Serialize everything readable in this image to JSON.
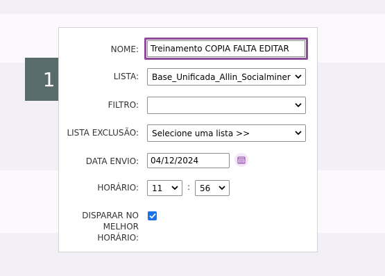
{
  "step": {
    "number": "1"
  },
  "form": {
    "nome": {
      "label": "NOME:",
      "value": "Treinamento COPIA FALTA EDITAR"
    },
    "lista": {
      "label": "LISTA:",
      "value": "Base_Unificada_Allin_Socialminer"
    },
    "filtro": {
      "label": "FILTRO:",
      "value": ""
    },
    "lista_exclusao": {
      "label": "LISTA EXCLUSÃO:",
      "value": "Selecione uma lista >>"
    },
    "data_envio": {
      "label": "DATA ENVIO:",
      "value": "04/12/2024"
    },
    "horario": {
      "label": "HORÁRIO:",
      "hour": "11",
      "minute": "56",
      "separator": ":"
    },
    "disparar": {
      "label_line1": "DISPARAR NO",
      "label_line2": "MELHOR",
      "label_line3": "HORÁRIO:",
      "checked": true
    }
  },
  "colors": {
    "accent": "#8e4b9c",
    "badge": "#5a6b6c",
    "checkbox": "#1a73e8"
  }
}
